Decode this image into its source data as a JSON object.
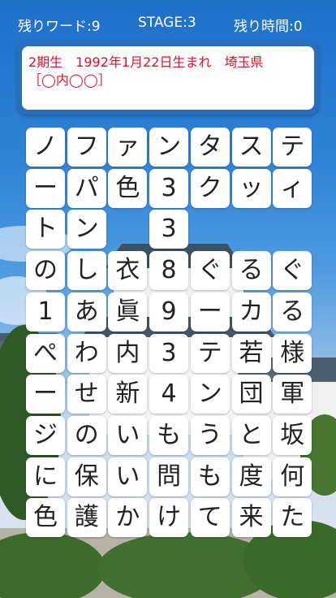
{
  "status": {
    "words_left": "残りワード:9",
    "stage": "STAGE:3",
    "time_left": "残り時間:0"
  },
  "clue": {
    "line1": "2期生　1992年1月22日生まれ　埼玉県",
    "line2": "［◯内◯◯］"
  },
  "board": {
    "rows": [
      [
        "ノ",
        "フ",
        "ァ",
        "ン",
        "タ",
        "ス",
        "テ"
      ],
      [
        "ー",
        "パ",
        "色",
        "3",
        "ク",
        "ッ",
        "ィ"
      ],
      [
        "ト",
        "ン",
        "",
        "3",
        "",
        "",
        ""
      ],
      [
        "の",
        "し",
        "衣",
        "8",
        "ぐ",
        "る",
        "ぐ"
      ],
      [
        "1",
        "あ",
        "眞",
        "9",
        "ー",
        "カ",
        "る"
      ],
      [
        "ぺ",
        "わ",
        "内",
        "3",
        "テ",
        "若",
        "様"
      ],
      [
        "ー",
        "せ",
        "新",
        "4",
        "ン",
        "団",
        "軍"
      ],
      [
        "ジ",
        "の",
        "い",
        "も",
        "う",
        "と",
        "坂"
      ],
      [
        "に",
        "保",
        "い",
        "問",
        "も",
        "度",
        "何"
      ],
      [
        "色",
        "護",
        "か",
        "け",
        "て",
        "来",
        "た"
      ]
    ]
  }
}
